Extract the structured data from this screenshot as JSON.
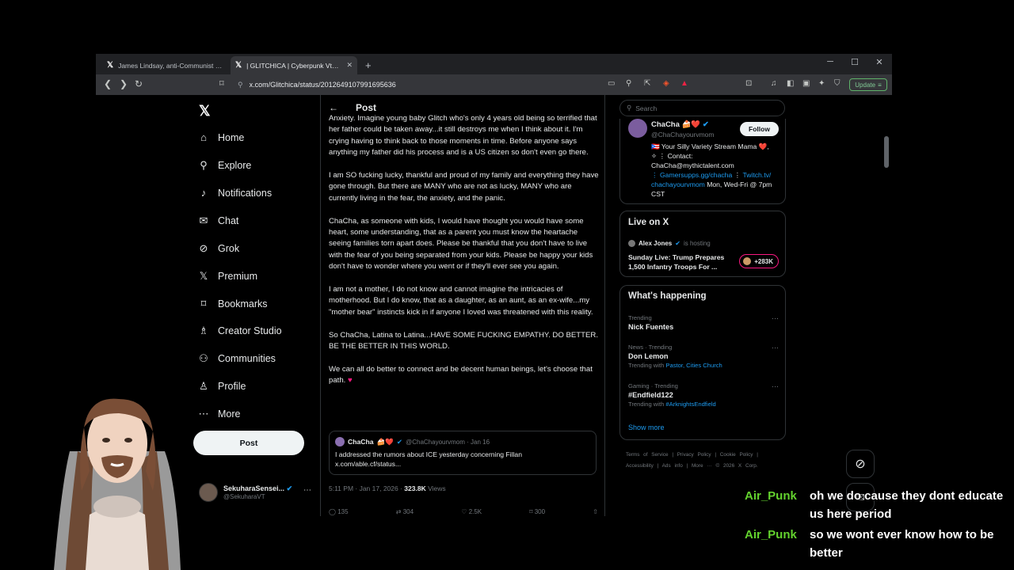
{
  "browser": {
    "tabs": [
      {
        "label": "James Lindsay, anti-Communist on X",
        "active": false
      },
      {
        "label": "| GLITCHICA | Cyberpunk Vtuber",
        "active": true
      }
    ],
    "url": "x.com/Glitchica/status/2012649107991695636",
    "update_label": "Update"
  },
  "nav": {
    "items": [
      {
        "label": "Home",
        "icon": "home-icon"
      },
      {
        "label": "Explore",
        "icon": "search-icon"
      },
      {
        "label": "Notifications",
        "icon": "bell-icon"
      },
      {
        "label": "Chat",
        "icon": "mail-icon"
      },
      {
        "label": "Grok",
        "icon": "grok-icon"
      },
      {
        "label": "Premium",
        "icon": "x-icon"
      },
      {
        "label": "Bookmarks",
        "icon": "bookmark-icon"
      },
      {
        "label": "Creator Studio",
        "icon": "flask-icon"
      },
      {
        "label": "Communities",
        "icon": "people-icon"
      },
      {
        "label": "Profile",
        "icon": "person-icon"
      },
      {
        "label": "More",
        "icon": "more-icon"
      }
    ],
    "post_button": "Post",
    "account": {
      "name": "SekuharaSensei...",
      "handle": "@SekuharaVT"
    }
  },
  "post": {
    "header": "Post",
    "paragraphs": [
      "Anxiety. Imagine young baby Glitch who's only 4 years old being so terrified that her father could be taken away...it still destroys me when I think about it. I'm crying having to think back to those moments in time. Before anyone says anything my father did his process and is a US citizen so don't even go there.",
      "I am SO fucking lucky, thankful and proud of my family and everything they have gone through. But there are MANY who are not as lucky, MANY who are currently living in the fear, the anxiety, and the panic.",
      "ChaCha, as someone with kids, I would have thought you would have some heart, some understanding, that as a parent you must know the heartache seeing families torn apart does. Please be thankful that you don't have to live with the fear of you being separated from your kids. Please be happy your kids don't have to wonder where you went or if they'll ever see you again.",
      "I am not a mother, I do not know and cannot imagine the intricacies of motherhood. But I do know, that as a daughter, as an aunt, as an ex-wife...my \"mother bear\" instincts kick in if anyone I loved was threatened with this reality.",
      "So ChaCha, Latina to Latina...HAVE SOME FUCKING EMPATHY. DO BETTER. BE THE BETTER IN THIS WORLD.",
      "We can all do better to connect and be decent human beings, let's choose that path."
    ],
    "heart": "♥",
    "quote": {
      "name": "ChaCha",
      "emoji": "🍰❤️",
      "meta": "@ChaChayourvmom · Jan 16",
      "text_line1": "I addressed the rumors about ICE yesterday concerning Fillan",
      "text_line2": "x.com/able.cf/status..."
    },
    "time": "5:11 PM · Jan 17, 2026 · ",
    "views_count": "323.8K",
    "views_label": " Views",
    "actions": [
      "135",
      "304",
      "2.5K",
      "300",
      ""
    ]
  },
  "right": {
    "search_placeholder": "Search",
    "profile": {
      "name": "ChaCha",
      "emoji": "🍰❤️",
      "handle": "@ChaChayourvmom",
      "follow": "Follow",
      "bio_line1": "🇵🇷 Your Silly Variety Stream Mama ❤️,",
      "bio_line2": "✧ ⋮ Contact:",
      "bio_line3": "ChaCha@mythictalent.com",
      "bio_link1": "⋮ Gamersupps.gg/chacha",
      "bio_sep": " ⋮ ",
      "bio_link2": "Twitch.tv/",
      "bio_link3": "chachayourvmom",
      "bio_tail": " Mon, Wed-Fri @ 7pm CST"
    },
    "live": {
      "title": "Live on X",
      "host": "Alex Jones",
      "hosting": "is hosting",
      "space_title": "Sunday Live: Trump Prepares 1,500 Infantry Troops For ...",
      "count": "+283K"
    },
    "happening": {
      "title": "What's happening",
      "trends": [
        {
          "category": "Trending",
          "name": "Nick Fuentes",
          "with_prefix": "",
          "with": ""
        },
        {
          "category": "News · Trending",
          "name": "Don Lemon",
          "with_prefix": "Trending with ",
          "with": "Pastor, Cities Church"
        },
        {
          "category": "Gaming · Trending",
          "name": "#Endfield122",
          "with_prefix": "Trending with ",
          "with": "#ArknightsEndfield"
        }
      ],
      "show_more": "Show more"
    },
    "footer": "Terms of Service | Privacy Policy | Cookie Policy | Accessibility | Ads info | More ··· © 2026 X Corp."
  },
  "chat": [
    {
      "user": "Air_Punk",
      "text": "oh we do cause they dont educate us here period"
    },
    {
      "user": "Air_Punk",
      "text": "so we wont ever know how to be better"
    }
  ],
  "colors": {
    "accent": "#1d9bf0",
    "chat_user": "#63d22e",
    "heart": "#f91880",
    "background": "#000000"
  }
}
